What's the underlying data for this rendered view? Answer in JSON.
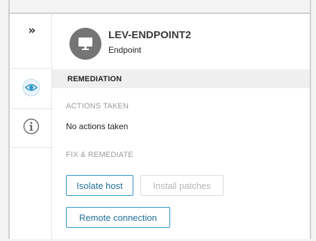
{
  "rail": {
    "expand_icon": "double-chevron-right-icon",
    "expand_glyph": "»",
    "remediation_icon": "eye-icon",
    "info_icon": "info-icon",
    "accent_color": "#2a93c9"
  },
  "header": {
    "title": "LEV-ENDPOINT2",
    "subtitle": "Endpoint",
    "avatar_icon": "monitor-icon"
  },
  "section": {
    "title": "REMEDIATION"
  },
  "actions_taken": {
    "label": "ACTIONS TAKEN",
    "value": "No actions taken"
  },
  "fix": {
    "label": "FIX & REMEDIATE",
    "buttons": {
      "isolate": "Isolate host",
      "patches": "Install patches",
      "remote": "Remote connection"
    }
  }
}
